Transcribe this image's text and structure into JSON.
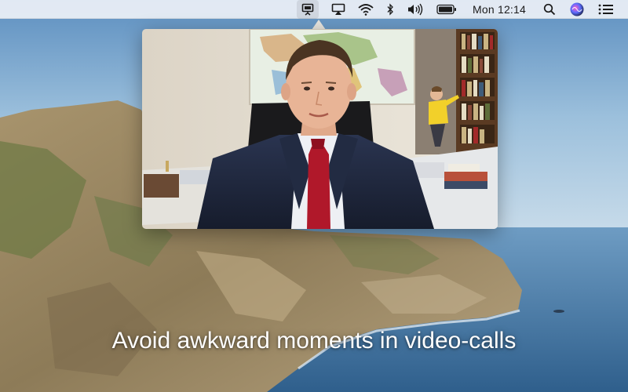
{
  "menubar": {
    "items": [
      {
        "icon": "presentation-screen-icon",
        "active": true
      },
      {
        "icon": "airplay-icon"
      },
      {
        "icon": "wifi-icon"
      },
      {
        "icon": "bluetooth-icon"
      },
      {
        "icon": "volume-icon"
      },
      {
        "icon": "battery-icon"
      }
    ],
    "clock": "Mon 12:14",
    "right_icons": [
      "spotlight-search-icon",
      "siri-icon",
      "notification-center-icon"
    ]
  },
  "popover": {
    "content": "video-call-preview",
    "scene_icons": [
      "world-map-icon",
      "bookshelf-icon",
      "person-icon",
      "child-icon"
    ]
  },
  "caption": "Avoid awkward moments in video-calls",
  "colors": {
    "menubar_bg": "#ecf0f6",
    "sky": "#7aa6c8",
    "sea": "#4f7ea6",
    "cliff": "#9c8a6a",
    "suit": "#1c2438",
    "tie": "#b0182a",
    "child_shirt": "#f2d02a"
  }
}
